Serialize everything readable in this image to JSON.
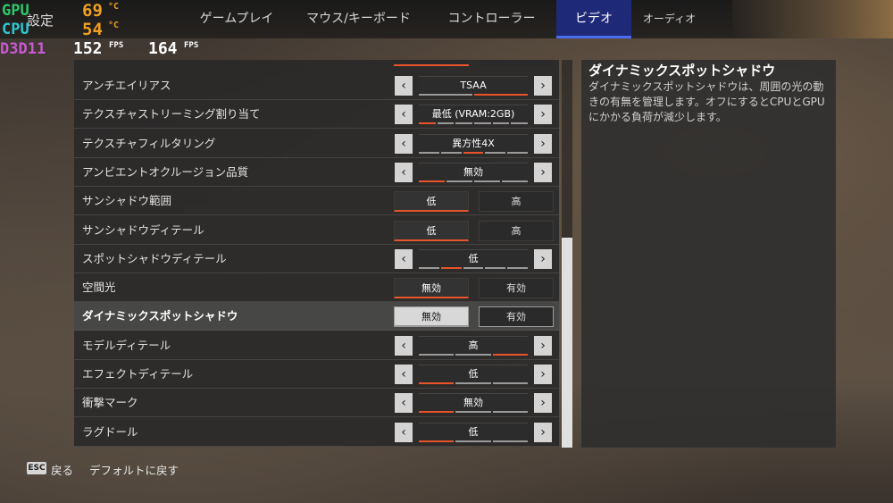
{
  "header": {
    "page_title": "設定",
    "tabs": [
      {
        "label": "ゲームプレイ"
      },
      {
        "label": "マウス/キーボード"
      },
      {
        "label": "コントローラー"
      },
      {
        "label": "ビデオ"
      },
      {
        "label": "オーディオ"
      }
    ],
    "active_tab": "ビデオ"
  },
  "overlay": {
    "gpu_label": "GPU",
    "cpu_label": "CPU",
    "gpu_temp": "69",
    "cpu_temp": "54",
    "temp_unit": "°C",
    "api": "D3D11",
    "fps1": "152",
    "fps2": "164",
    "fps_unit": "FPS"
  },
  "settings": [
    {
      "label": "アンチエイリアス",
      "type": "selector",
      "value": "TSAA",
      "segments": 2,
      "active_segment": 2
    },
    {
      "label": "テクスチャストリーミング割り当て",
      "type": "selector",
      "value": "最低 (VRAM:2GB)",
      "segments": 6,
      "active_segment": 1
    },
    {
      "label": "テクスチャフィルタリング",
      "type": "selector",
      "value": "異方性4X",
      "segments": 5,
      "active_segment": 3
    },
    {
      "label": "アンビエントオクルージョン品質",
      "type": "selector",
      "value": "無効",
      "segments": 4,
      "active_segment": 1
    },
    {
      "label": "サンシャドウ範囲",
      "type": "toggle",
      "options": [
        "低",
        "高"
      ],
      "active": 0
    },
    {
      "label": "サンシャドウディテール",
      "type": "toggle",
      "options": [
        "低",
        "高"
      ],
      "active": 0
    },
    {
      "label": "スポットシャドウディテール",
      "type": "selector",
      "value": "低",
      "segments": 5,
      "active_segment": 2
    },
    {
      "label": "空間光",
      "type": "toggle",
      "options": [
        "無効",
        "有効"
      ],
      "active": 0
    },
    {
      "label": "ダイナミックスポットシャドウ",
      "type": "toggle",
      "options": [
        "無効",
        "有効"
      ],
      "active": 0,
      "selected": true
    },
    {
      "label": "モデルディテール",
      "type": "selector",
      "value": "高",
      "segments": 3,
      "active_segment": 3
    },
    {
      "label": "エフェクトディテール",
      "type": "selector",
      "value": "低",
      "segments": 3,
      "active_segment": 1
    },
    {
      "label": "衝撃マーク",
      "type": "selector",
      "value": "無効",
      "segments": 3,
      "active_segment": 1
    },
    {
      "label": "ラグドール",
      "type": "selector",
      "value": "低",
      "segments": 3,
      "active_segment": 1
    }
  ],
  "scrollbar": {
    "position_fraction": 0.46,
    "visible_fraction": 0.54
  },
  "description": {
    "title": "ダイナミックスポットシャドウ",
    "body": "ダイナミックスポットシャドウは、周囲の光の動きの有無を管理します。オフにするとCPUとGPUにかかる負荷が減少します。"
  },
  "footer": {
    "esc_key": "ESC",
    "back_label": "戻る",
    "reset_label": "デフォルトに戻す"
  },
  "colors": {
    "accent": "#e8542a",
    "tab_active_bg": "#1e2a78"
  }
}
